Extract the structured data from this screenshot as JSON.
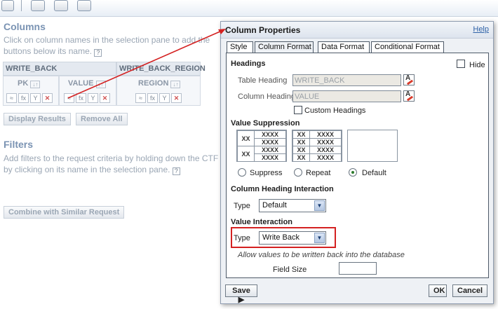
{
  "background": {
    "columns_title": "Columns",
    "columns_help_1": "Click on column names in the selection pane to add the",
    "columns_help_2": "buttons below its name.",
    "group_write_back": "WRITE_BACK",
    "group_write_back_region": "WRITE_BACK_REGION",
    "col_pk": "PK",
    "col_value": "VALUE",
    "col_region": "REGION",
    "display_results": "Display Results",
    "remove_all": "Remove All",
    "filters_title": "Filters",
    "filters_help_1": "Add filters to the request criteria by holding down the CTF",
    "filters_help_2": "by clicking on its name in the selection pane.",
    "combine_button": "Combine with Similar Request"
  },
  "dialog": {
    "title": "Column Properties",
    "help_link": "Help",
    "tabs": [
      {
        "label": "Style"
      },
      {
        "label": "Column Format"
      },
      {
        "label": "Data Format"
      },
      {
        "label": "Conditional Format"
      }
    ],
    "active_tab": "Column Format",
    "headings": {
      "section": "Headings",
      "hide_label": "Hide",
      "table_heading_label": "Table Heading",
      "table_heading_value": "WRITE_BACK",
      "column_heading_label": "Column Heading",
      "column_heading_value": "VALUE",
      "custom_headings_label": "Custom Headings"
    },
    "value_suppression": {
      "section": "Value Suppression",
      "grid_label_xx": "XX",
      "grid_label_xxxx": "XXXX",
      "options": [
        {
          "label": "Suppress",
          "selected": false
        },
        {
          "label": "Repeat",
          "selected": false
        },
        {
          "label": "Default",
          "selected": true
        }
      ]
    },
    "column_heading_interaction": {
      "section": "Column Heading Interaction",
      "type_label": "Type",
      "type_value": "Default"
    },
    "value_interaction": {
      "section": "Value Interaction",
      "type_label": "Type",
      "type_value": "Write Back",
      "hint": "Allow values to be written back into the database",
      "field_size_label": "Field Size",
      "field_size_value": ""
    },
    "footer": {
      "save_label": "Save",
      "ok_label": "OK",
      "cancel_label": "Cancel"
    }
  },
  "colors": {
    "highlight": "#d42121",
    "help_link": "#2f63a8"
  }
}
